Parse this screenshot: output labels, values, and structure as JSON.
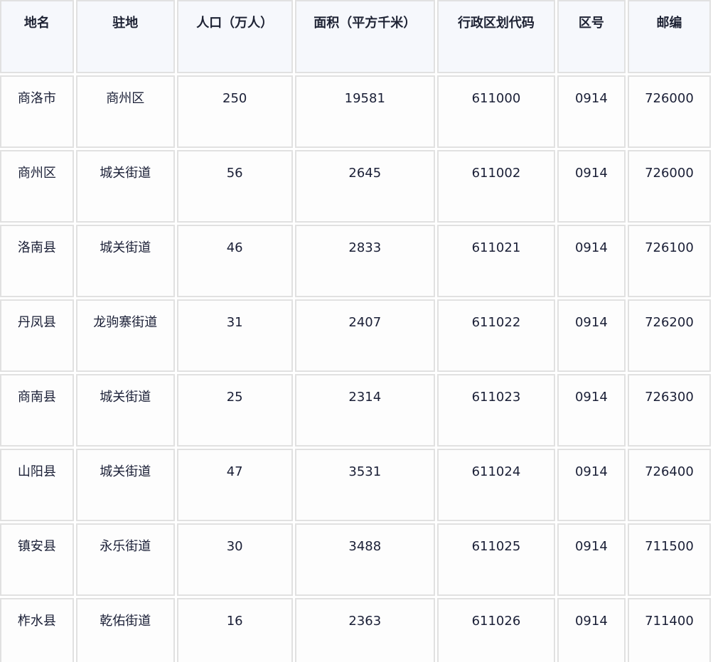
{
  "table": {
    "headers": [
      "地名",
      "驻地",
      "人口（万人）",
      "面积（平方千米）",
      "行政区划代码",
      "区号",
      "邮编"
    ],
    "rows": [
      [
        "商洛市",
        "商州区",
        "250",
        "19581",
        "611000",
        "0914",
        "726000"
      ],
      [
        "商州区",
        "城关街道",
        "56",
        "2645",
        "611002",
        "0914",
        "726000"
      ],
      [
        "洛南县",
        "城关街道",
        "46",
        "2833",
        "611021",
        "0914",
        "726100"
      ],
      [
        "丹凤县",
        "龙驹寨街道",
        "31",
        "2407",
        "611022",
        "0914",
        "726200"
      ],
      [
        "商南县",
        "城关街道",
        "25",
        "2314",
        "611023",
        "0914",
        "726300"
      ],
      [
        "山阳县",
        "城关街道",
        "47",
        "3531",
        "611024",
        "0914",
        "726400"
      ],
      [
        "镇安县",
        "永乐街道",
        "30",
        "3488",
        "611025",
        "0914",
        "711500"
      ],
      [
        "柞水县",
        "乾佑街道",
        "16",
        "2363",
        "611026",
        "0914",
        "711400"
      ]
    ]
  }
}
